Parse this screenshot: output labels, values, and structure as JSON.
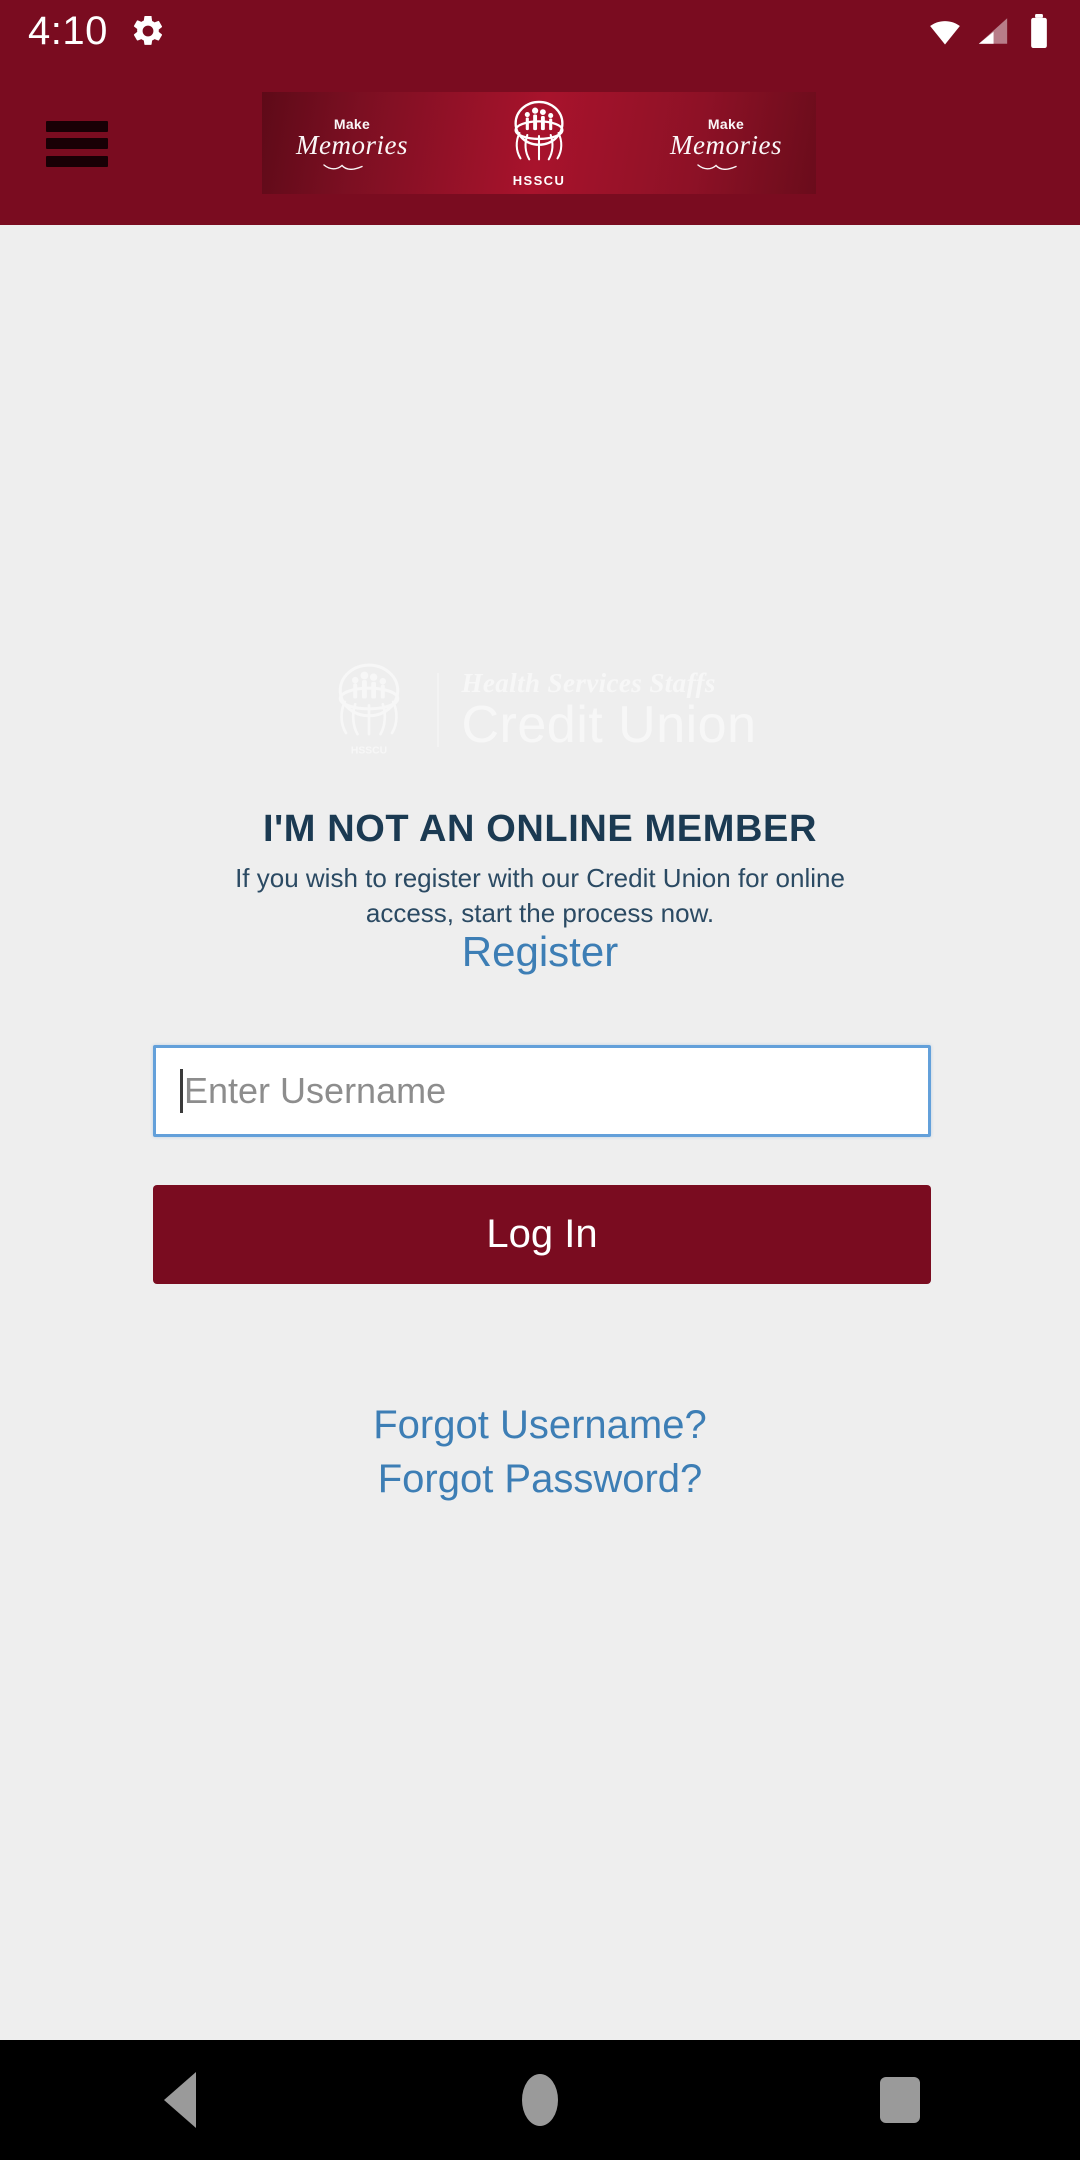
{
  "status_bar": {
    "time": "4:10",
    "icons": [
      "gear-icon",
      "wifi-icon",
      "cell-signal-icon",
      "battery-icon"
    ],
    "background_color": "#7a0c20"
  },
  "header": {
    "menu_icon": "hamburger-menu-icon",
    "banner": {
      "left_tagline_small": "Make",
      "left_tagline_script": "Memories",
      "right_tagline_small": "Make",
      "right_tagline_script": "Memories",
      "logo_label": "HSSCU",
      "logo_icon": "hsscu-hands-family-logo-icon"
    }
  },
  "main": {
    "watermark": {
      "line1": "Health Services Staffs",
      "line2": "Credit Union",
      "logo_icon": "hsscu-hands-family-logo-icon"
    },
    "heading": "I'M NOT AN ONLINE MEMBER",
    "subtext": "If you wish to register with our Credit Union for online access, start the process now.",
    "register_label": "Register",
    "username_field": {
      "placeholder": "Enter Username",
      "value": ""
    },
    "login_button_label": "Log In",
    "forgot_username_label": "Forgot Username?",
    "forgot_password_label": "Forgot Password?"
  },
  "nav_bar": {
    "back_label": "Back",
    "home_label": "Home",
    "recents_label": "Recents"
  },
  "colors": {
    "brand_maroon": "#7a0c20",
    "page_background": "#eeeeee",
    "heading_navy": "#1b3a52",
    "link_blue": "#3d7eb5",
    "input_border_blue": "#63a0da",
    "nav_glyph_gray": "#9a9a9a"
  }
}
